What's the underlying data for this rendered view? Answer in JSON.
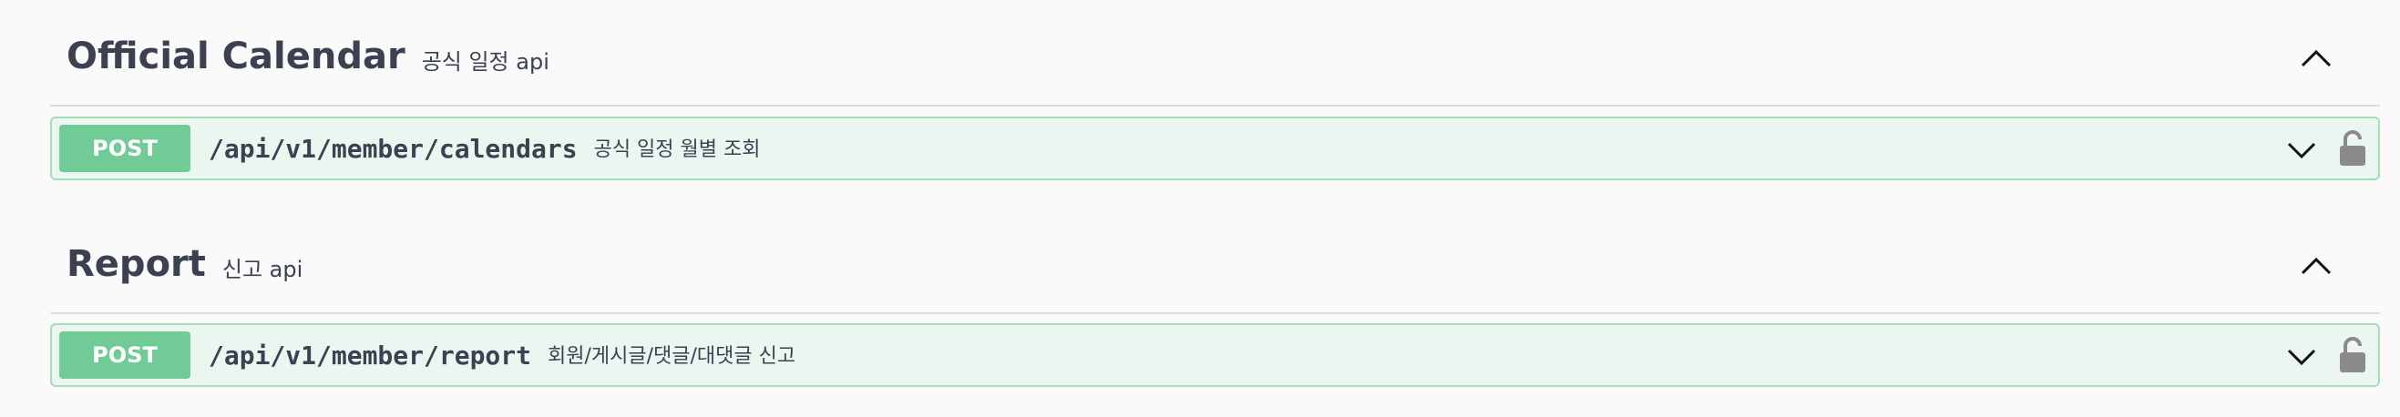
{
  "sections": [
    {
      "tag": "Official Calendar",
      "description": "공식 일정 api",
      "operation": {
        "method": "POST",
        "path": "/api/v1/member/calendars",
        "summary": "공식 일정 월별 조회"
      }
    },
    {
      "tag": "Report",
      "description": "신고 api",
      "operation": {
        "method": "POST",
        "path": "/api/v1/member/report",
        "summary": "회원/게시글/댓글/대댓글 신고"
      }
    }
  ],
  "icons": {
    "tag_toggle": "chevron-up-icon",
    "op_toggle": "chevron-down-icon",
    "auth": "lock-icon"
  },
  "colors": {
    "post_method": "#71cb97",
    "post_background": "#ebf6f0",
    "post_border": "#a6dcb8",
    "text": "#3b4151",
    "lock": "#8a8a8a"
  }
}
